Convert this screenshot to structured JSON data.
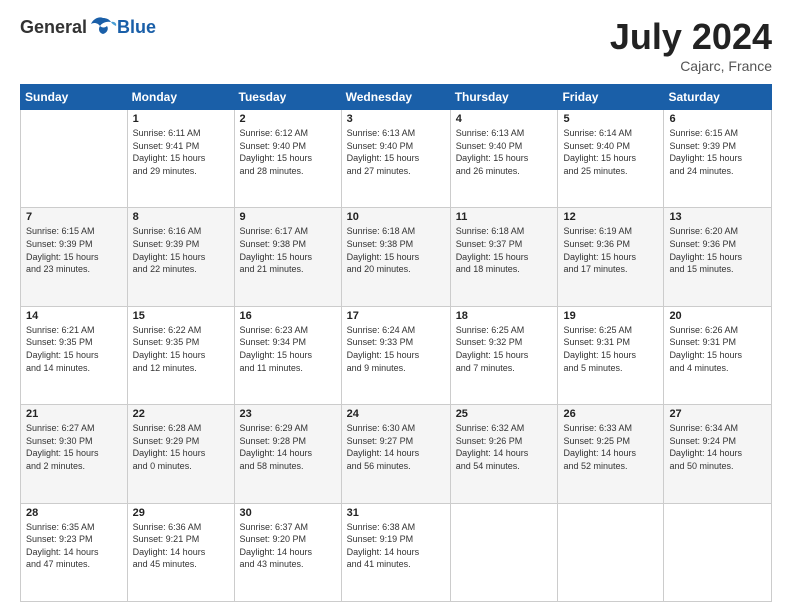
{
  "header": {
    "logo_general": "General",
    "logo_blue": "Blue",
    "month_title": "July 2024",
    "location": "Cajarc, France"
  },
  "days_of_week": [
    "Sunday",
    "Monday",
    "Tuesday",
    "Wednesday",
    "Thursday",
    "Friday",
    "Saturday"
  ],
  "weeks": [
    [
      {
        "day": "",
        "info": ""
      },
      {
        "day": "1",
        "info": "Sunrise: 6:11 AM\nSunset: 9:41 PM\nDaylight: 15 hours\nand 29 minutes."
      },
      {
        "day": "2",
        "info": "Sunrise: 6:12 AM\nSunset: 9:40 PM\nDaylight: 15 hours\nand 28 minutes."
      },
      {
        "day": "3",
        "info": "Sunrise: 6:13 AM\nSunset: 9:40 PM\nDaylight: 15 hours\nand 27 minutes."
      },
      {
        "day": "4",
        "info": "Sunrise: 6:13 AM\nSunset: 9:40 PM\nDaylight: 15 hours\nand 26 minutes."
      },
      {
        "day": "5",
        "info": "Sunrise: 6:14 AM\nSunset: 9:40 PM\nDaylight: 15 hours\nand 25 minutes."
      },
      {
        "day": "6",
        "info": "Sunrise: 6:15 AM\nSunset: 9:39 PM\nDaylight: 15 hours\nand 24 minutes."
      }
    ],
    [
      {
        "day": "7",
        "info": "Sunrise: 6:15 AM\nSunset: 9:39 PM\nDaylight: 15 hours\nand 23 minutes."
      },
      {
        "day": "8",
        "info": "Sunrise: 6:16 AM\nSunset: 9:39 PM\nDaylight: 15 hours\nand 22 minutes."
      },
      {
        "day": "9",
        "info": "Sunrise: 6:17 AM\nSunset: 9:38 PM\nDaylight: 15 hours\nand 21 minutes."
      },
      {
        "day": "10",
        "info": "Sunrise: 6:18 AM\nSunset: 9:38 PM\nDaylight: 15 hours\nand 20 minutes."
      },
      {
        "day": "11",
        "info": "Sunrise: 6:18 AM\nSunset: 9:37 PM\nDaylight: 15 hours\nand 18 minutes."
      },
      {
        "day": "12",
        "info": "Sunrise: 6:19 AM\nSunset: 9:36 PM\nDaylight: 15 hours\nand 17 minutes."
      },
      {
        "day": "13",
        "info": "Sunrise: 6:20 AM\nSunset: 9:36 PM\nDaylight: 15 hours\nand 15 minutes."
      }
    ],
    [
      {
        "day": "14",
        "info": "Sunrise: 6:21 AM\nSunset: 9:35 PM\nDaylight: 15 hours\nand 14 minutes."
      },
      {
        "day": "15",
        "info": "Sunrise: 6:22 AM\nSunset: 9:35 PM\nDaylight: 15 hours\nand 12 minutes."
      },
      {
        "day": "16",
        "info": "Sunrise: 6:23 AM\nSunset: 9:34 PM\nDaylight: 15 hours\nand 11 minutes."
      },
      {
        "day": "17",
        "info": "Sunrise: 6:24 AM\nSunset: 9:33 PM\nDaylight: 15 hours\nand 9 minutes."
      },
      {
        "day": "18",
        "info": "Sunrise: 6:25 AM\nSunset: 9:32 PM\nDaylight: 15 hours\nand 7 minutes."
      },
      {
        "day": "19",
        "info": "Sunrise: 6:25 AM\nSunset: 9:31 PM\nDaylight: 15 hours\nand 5 minutes."
      },
      {
        "day": "20",
        "info": "Sunrise: 6:26 AM\nSunset: 9:31 PM\nDaylight: 15 hours\nand 4 minutes."
      }
    ],
    [
      {
        "day": "21",
        "info": "Sunrise: 6:27 AM\nSunset: 9:30 PM\nDaylight: 15 hours\nand 2 minutes."
      },
      {
        "day": "22",
        "info": "Sunrise: 6:28 AM\nSunset: 9:29 PM\nDaylight: 15 hours\nand 0 minutes."
      },
      {
        "day": "23",
        "info": "Sunrise: 6:29 AM\nSunset: 9:28 PM\nDaylight: 14 hours\nand 58 minutes."
      },
      {
        "day": "24",
        "info": "Sunrise: 6:30 AM\nSunset: 9:27 PM\nDaylight: 14 hours\nand 56 minutes."
      },
      {
        "day": "25",
        "info": "Sunrise: 6:32 AM\nSunset: 9:26 PM\nDaylight: 14 hours\nand 54 minutes."
      },
      {
        "day": "26",
        "info": "Sunrise: 6:33 AM\nSunset: 9:25 PM\nDaylight: 14 hours\nand 52 minutes."
      },
      {
        "day": "27",
        "info": "Sunrise: 6:34 AM\nSunset: 9:24 PM\nDaylight: 14 hours\nand 50 minutes."
      }
    ],
    [
      {
        "day": "28",
        "info": "Sunrise: 6:35 AM\nSunset: 9:23 PM\nDaylight: 14 hours\nand 47 minutes."
      },
      {
        "day": "29",
        "info": "Sunrise: 6:36 AM\nSunset: 9:21 PM\nDaylight: 14 hours\nand 45 minutes."
      },
      {
        "day": "30",
        "info": "Sunrise: 6:37 AM\nSunset: 9:20 PM\nDaylight: 14 hours\nand 43 minutes."
      },
      {
        "day": "31",
        "info": "Sunrise: 6:38 AM\nSunset: 9:19 PM\nDaylight: 14 hours\nand 41 minutes."
      },
      {
        "day": "",
        "info": ""
      },
      {
        "day": "",
        "info": ""
      },
      {
        "day": "",
        "info": ""
      }
    ]
  ]
}
